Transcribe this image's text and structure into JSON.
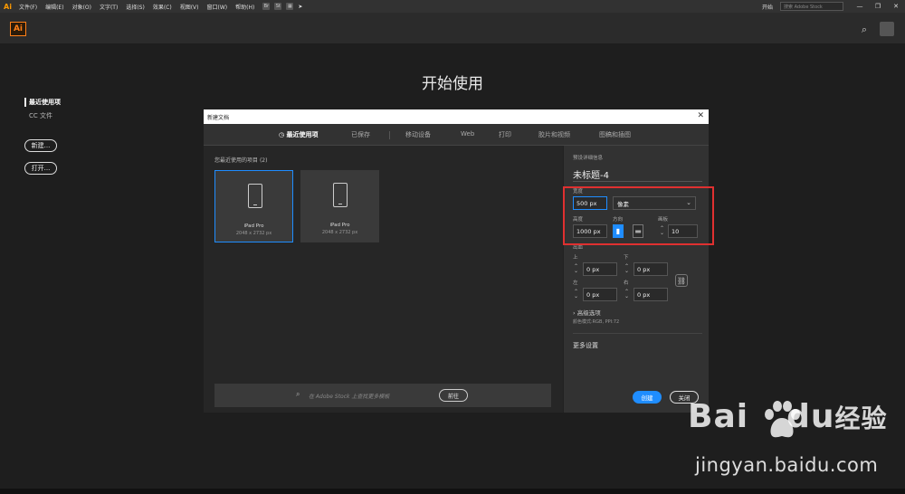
{
  "menubar": {
    "app_mark": "Ai",
    "items": [
      "文件(F)",
      "编辑(E)",
      "对象(O)",
      "文字(T)",
      "选择(S)",
      "效果(C)",
      "视图(V)",
      "窗口(W)",
      "帮助(H)"
    ],
    "quick_icons": [
      "Br",
      "St"
    ],
    "workspace": "开始",
    "stock_search_placeholder": "搜索 Adobe Stock",
    "window_buttons": [
      "—",
      "❐",
      "✕"
    ]
  },
  "appbar": {
    "logo": "Ai"
  },
  "home": {
    "title": "开始使用",
    "nav": {
      "recent": "最近使用项",
      "cc_files": "CC 文件"
    },
    "new_button": "新建...",
    "open_button": "打开..."
  },
  "dialog": {
    "title": "新建文档",
    "close": "✕",
    "tabs": [
      "最近使用项",
      "已保存",
      "移动设备",
      "Web",
      "打印",
      "胶片和视频",
      "图稿和插图"
    ],
    "active_tab": 0,
    "recent_label": "您最近使用的项目",
    "recent_count": "(2)",
    "cards": [
      {
        "name": "iPad Pro",
        "dims": "2048 x 2732 px"
      },
      {
        "name": "iPad Pro",
        "dims": "2048 x 2732 px"
      }
    ],
    "stock_placeholder": "在 Adobe Stock 上查找更多模板",
    "go_button": "前往",
    "preset": {
      "section_label": "预设详细信息",
      "doc_name": "未标题-4",
      "width_label": "宽度",
      "width_value": "500 px",
      "unit": "像素",
      "height_label": "高度",
      "height_value": "1000 px",
      "orientation_label": "方向",
      "artboards_label": "画板",
      "artboards_value": "10",
      "bleed_label": "出血",
      "top_label": "上",
      "top_value": "0 px",
      "bottom_label": "下",
      "bottom_value": "0 px",
      "left_label": "左",
      "left_value": "0 px",
      "right_label": "右",
      "right_value": "0 px",
      "advanced": "高级选项",
      "color_mode": "颜色模式:RGB, PPI:72",
      "more_settings": "更多设置",
      "create_button": "创建",
      "close_button": "关闭"
    }
  },
  "watermark": {
    "brand": "Bai",
    "brand_suffix": "du",
    "brand_cn": "经验",
    "url": "jingyan.baidu.com"
  },
  "colors": {
    "accent": "#1f8dff",
    "highlight": "#e03030",
    "ai_orange": "#ff7f18"
  }
}
